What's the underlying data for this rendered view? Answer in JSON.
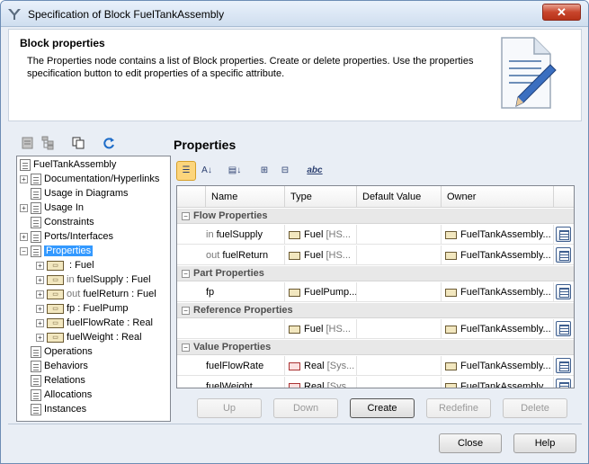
{
  "window": {
    "title": "Specification of Block FuelTankAssembly",
    "close_label": "✕"
  },
  "header": {
    "heading": "Block properties",
    "description": "The Properties node contains a list of Block properties. Create or delete properties. Use the properties specification button to edit properties of a specific attribute."
  },
  "tree": {
    "root": "FuelTankAssembly",
    "items": [
      {
        "label": "Documentation/Hyperlinks"
      },
      {
        "label": "Usage in Diagrams"
      },
      {
        "label": "Usage In"
      },
      {
        "label": "Constraints"
      },
      {
        "label": "Ports/Interfaces"
      },
      {
        "label": "Properties"
      },
      {
        "label": "Operations"
      },
      {
        "label": "Behaviors"
      },
      {
        "label": "Relations"
      },
      {
        "label": "Allocations"
      },
      {
        "label": "Instances"
      }
    ],
    "props": [
      {
        "prefix": "",
        "name": " : Fuel"
      },
      {
        "prefix": "in ",
        "name": "fuelSupply : Fuel"
      },
      {
        "prefix": "out ",
        "name": "fuelReturn : Fuel"
      },
      {
        "prefix": "",
        "name": "fp : FuelPump"
      },
      {
        "prefix": "",
        "name": "fuelFlowRate : Real"
      },
      {
        "prefix": "",
        "name": "fuelWeight : Real"
      }
    ]
  },
  "properties": {
    "title": "Properties",
    "columns": [
      "Name",
      "Type",
      "Default Value",
      "Owner"
    ],
    "groups": [
      {
        "label": "Flow Properties"
      },
      {
        "label": "Part Properties"
      },
      {
        "label": "Reference Properties"
      },
      {
        "label": "Value Properties"
      }
    ],
    "rows": [
      {
        "prefix": "in ",
        "name": "fuelSupply",
        "type": "Fuel",
        "type_ctx": " [HS...",
        "owner": "FuelTankAssembly..."
      },
      {
        "prefix": "out ",
        "name": "fuelReturn",
        "type": "Fuel",
        "type_ctx": " [HS...",
        "owner": "FuelTankAssembly..."
      },
      {
        "prefix": "",
        "name": "fp",
        "type": "FuelPump...",
        "type_ctx": "",
        "owner": "FuelTankAssembly..."
      },
      {
        "prefix": "",
        "name": "",
        "type": "Fuel",
        "type_ctx": " [HS...",
        "owner": "FuelTankAssembly..."
      },
      {
        "prefix": "",
        "name": "fuelFlowRate",
        "type": "Real",
        "type_ctx": " [Sys...",
        "owner": "FuelTankAssembly..."
      },
      {
        "prefix": "",
        "name": "fuelWeight",
        "type": "Real",
        "type_ctx": " [Sys...",
        "owner": "FuelTankAssembly..."
      }
    ],
    "buttons": {
      "up": "Up",
      "down": "Down",
      "create": "Create",
      "redefine": "Redefine",
      "delete": "Delete"
    }
  },
  "toolbar_icons": {
    "tree": [
      "expand-tree-icon",
      "hierarchy-icon",
      "copy-icon",
      "refresh-icon"
    ],
    "table": [
      "group-by-category-icon",
      "sort-alphabetically-icon",
      "sort-by-type-icon",
      "expand-all-icon",
      "collapse-all-icon",
      "spell-check-icon"
    ],
    "spell_label": "abc"
  },
  "footer": {
    "close": "Close",
    "help": "Help"
  },
  "colors": {
    "selection": "#3399ff",
    "window_bg": "#e9eef5"
  }
}
